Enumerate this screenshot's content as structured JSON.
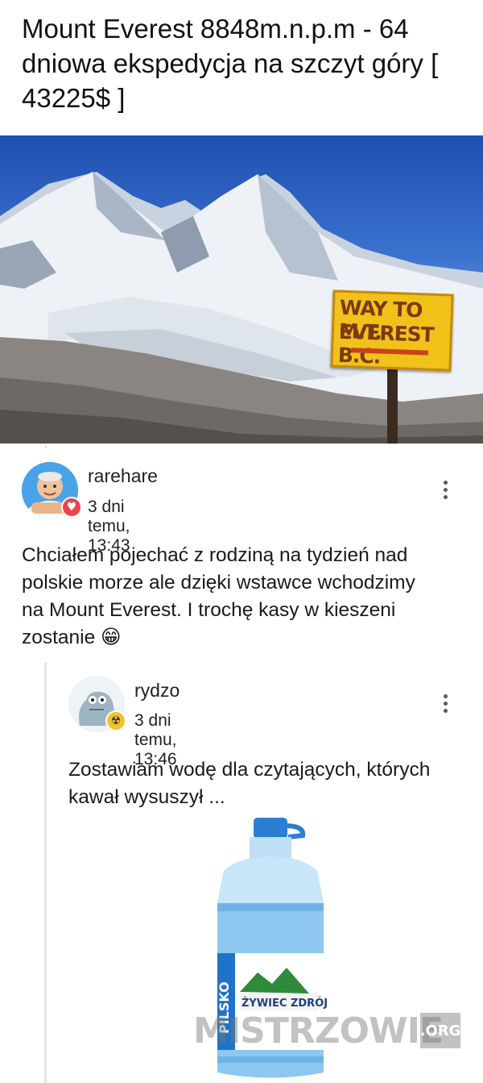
{
  "post": {
    "title": "Mount Everest 8848m.n.p.m - 64 dniowa ekspedycja na szczyt góry [ 43225$ ]",
    "image": {
      "sign_line1": "WAY TO M.T.",
      "sign_line2": "EVEREST B.C."
    }
  },
  "comments": [
    {
      "username": "rarehare",
      "timestamp": "3 dni temu, 13:43",
      "badge_icon": "heart-icon",
      "body": "Chciałem pojechać z rodziną na tydzień nad polskie morze ale dzięki wstawce wchodzimy na Mount Everest. I trochę kasy w kieszeni zostanie 😁"
    },
    {
      "username": "rydzo",
      "timestamp": "3 dni temu, 13:46",
      "badge_icon": "radiation-icon",
      "body": "Zostawiam wodę dla czytających, których kawał wysuszył ...",
      "image": {
        "bottle_brand": "ŻYWIEC ZDRÓJ",
        "bottle_side": "PILSKO"
      }
    }
  ],
  "watermark": {
    "text": "MISTRZOWIE",
    "suffix": ".ORG"
  },
  "colors": {
    "heart_badge": "#e8464b",
    "radiation_badge": "#f2c230",
    "thread_line": "#e3e3e3"
  }
}
